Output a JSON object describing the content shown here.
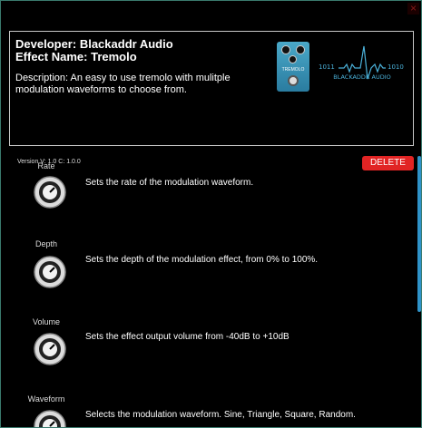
{
  "window": {
    "close_glyph": "×"
  },
  "header": {
    "developer_label": "Developer:",
    "developer": "Blackaddr Audio",
    "effect_label": "Effect Name:",
    "effect_name": "Tremolo",
    "description_label": "Description:",
    "description": "An easy to use tremolo with mulitple modulation waveforms to choose from.",
    "pedal_text": "TREMOLO",
    "brand_left": "1011",
    "brand_right": "1010",
    "brand_name": "BLACKADDR AUDIO"
  },
  "version_text": "Version V: 1.0  C: 1.0.0",
  "delete_label": "DELETE",
  "params": [
    {
      "label": "Rate",
      "description": "Sets the rate of the modulation waveform."
    },
    {
      "label": "Depth",
      "description": "Sets the depth of the modulation effect, from 0% to 100%."
    },
    {
      "label": "Volume",
      "description": "Sets the effect output volume from -40dB to +10dB"
    },
    {
      "label": "Waveform",
      "description": "Selects the modulation waveform. Sine, Triangle, Square, Random."
    }
  ],
  "colors": {
    "border": "#3a7a6e",
    "delete": "#e12424",
    "scrollbar": "#2f93c9",
    "brand": "#4ab0d8"
  },
  "icons": {
    "close": "close-icon",
    "knob": "knob-icon",
    "pedal": "pedal-logo-icon",
    "brand": "brand-logo-icon"
  }
}
